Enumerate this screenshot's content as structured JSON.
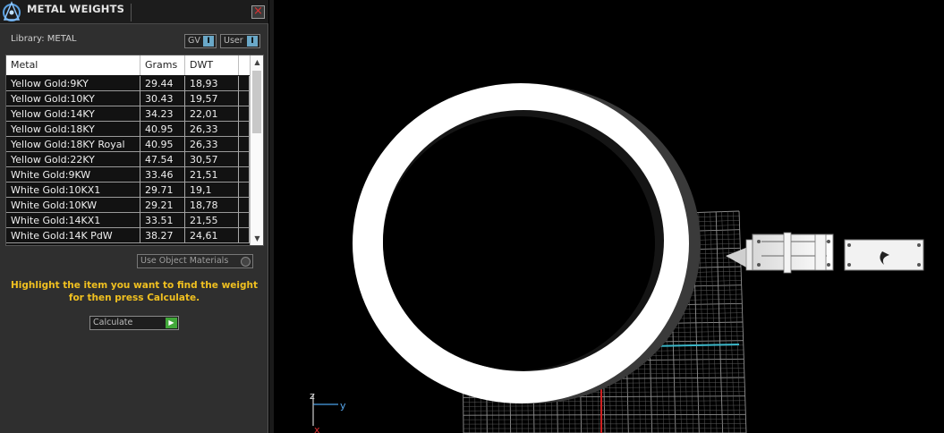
{
  "panel": {
    "title": "METAL WEIGHTS",
    "close_label": "×",
    "library_label": "Library: METAL",
    "gv_button": "GV",
    "user_button": "User",
    "use_object_materials": "Use Object Materials",
    "hint_line1": "Highlight the item you want to find the weight",
    "hint_line2": "for then press Calculate.",
    "calculate_label": "Calculate"
  },
  "table": {
    "columns": [
      "Metal",
      "Grams",
      "DWT"
    ],
    "rows": [
      [
        "Yellow Gold:9KY",
        "29.44",
        "18,93"
      ],
      [
        "Yellow Gold:10KY",
        "30.43",
        "19,57"
      ],
      [
        "Yellow Gold:14KY",
        "34.23",
        "22,01"
      ],
      [
        "Yellow Gold:18KY",
        "40.95",
        "26,33"
      ],
      [
        "Yellow Gold:18KY Royal",
        "40.95",
        "26,33"
      ],
      [
        "Yellow Gold:22KY",
        "47.54",
        "30,57"
      ],
      [
        "White Gold:9KW",
        "33.46",
        "21,51"
      ],
      [
        "White Gold:10KX1",
        "29.71",
        "19,1"
      ],
      [
        "White Gold:10KW",
        "29.21",
        "18,78"
      ],
      [
        "White Gold:14KX1",
        "33.51",
        "21,55"
      ],
      [
        "White Gold:14K PdW",
        "38.27",
        "24,61"
      ]
    ]
  },
  "viewport": {
    "axis_z": "z",
    "axis_y": "y",
    "axis_x": "x"
  },
  "colors": {
    "panel_bg": "#2f2f2f",
    "hint_text": "#f0c020",
    "accent_green": "#42a83a",
    "grid_line": "#8a8a8a"
  }
}
